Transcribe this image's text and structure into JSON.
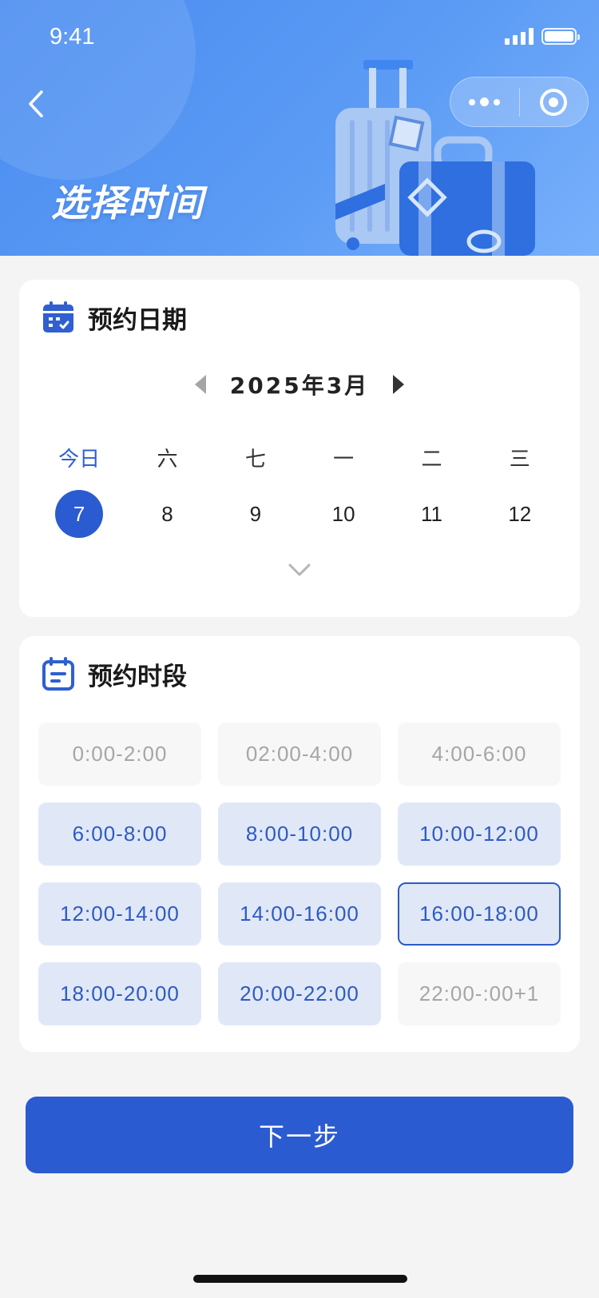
{
  "status_bar": {
    "time": "9:41"
  },
  "header": {
    "title": "选择时间",
    "back_icon": "chevron-left-icon",
    "capsule": {
      "more_icon": "more-dots-icon",
      "close_icon": "target-circle-icon"
    }
  },
  "date_card": {
    "title": "预约日期",
    "icon": "calendar-icon",
    "month_label": "2025年3月",
    "prev_icon": "triangle-left-icon",
    "next_icon": "triangle-right-icon",
    "days": [
      {
        "weekday": "今日",
        "date": "7",
        "selected": true,
        "today": true
      },
      {
        "weekday": "六",
        "date": "8"
      },
      {
        "weekday": "七",
        "date": "9"
      },
      {
        "weekday": "一",
        "date": "10"
      },
      {
        "weekday": "二",
        "date": "11"
      },
      {
        "weekday": "三",
        "date": "12"
      }
    ],
    "expand_icon": "chevron-down-icon"
  },
  "time_card": {
    "title": "预约时段",
    "icon": "calendar-list-icon",
    "slots": [
      {
        "label": "0:00-2:00",
        "state": "disabled"
      },
      {
        "label": "02:00-4:00",
        "state": "disabled"
      },
      {
        "label": "4:00-6:00",
        "state": "disabled"
      },
      {
        "label": "6:00-8:00",
        "state": "available"
      },
      {
        "label": "8:00-10:00",
        "state": "available"
      },
      {
        "label": "10:00-12:00",
        "state": "available"
      },
      {
        "label": "12:00-14:00",
        "state": "available"
      },
      {
        "label": "14:00-16:00",
        "state": "available"
      },
      {
        "label": "16:00-18:00",
        "state": "selected"
      },
      {
        "label": "18:00-20:00",
        "state": "available"
      },
      {
        "label": "20:00-22:00",
        "state": "available"
      },
      {
        "label": "22:00-:00+1",
        "state": "disabled"
      }
    ]
  },
  "footer": {
    "next_label": "下一步"
  },
  "colors": {
    "primary": "#2b5bd0",
    "slot_bg": "#e0e8f8",
    "header_bg": "#5b9bf5"
  }
}
